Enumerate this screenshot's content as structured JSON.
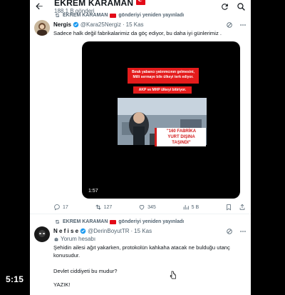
{
  "header": {
    "title": "EKREM KARAMAN",
    "post_count": "188,1 B gönderi"
  },
  "tweet1": {
    "retweet_by": "EKREM KARAMAN",
    "retweet_label": "gönderiyi yeniden yayınladı",
    "name": "Nergis",
    "handle": "@Kara25Nergiz",
    "dot": "·",
    "date": "15 Kas",
    "text": "Sadece halk değil fabrikalarimiz da göç ediyor, bu daha iyi günlerimiz .",
    "video": {
      "banner1_line1": "Bırak yabancı yatırımcının gelmesini,",
      "banner1_line2": "Milli sermaye bile ülkeyi terk ediyor.",
      "banner2": "AKP ve MHP ülkeyi bitiriyor.",
      "caption_line1": "\"160 FABRİKA",
      "caption_line2": "YURT DIŞINA",
      "caption_line3": "TAŞINDI\"",
      "duration": "1:57"
    },
    "actions": {
      "replies": "17",
      "reposts": "127",
      "likes": "345",
      "views": "5 B"
    }
  },
  "tweet2": {
    "retweet_by": "EKREM KARAMAN",
    "retweet_label": "gönderiyi yeniden yayınladı",
    "name": "N e f i s e",
    "handle": "@DerinBoyutTR",
    "dot": "·",
    "date": "15 Kas",
    "account_type": "Yorum hesabı",
    "text_line1": "Şehidin ailesi ağıt yakarken, protokolün kahkaha atacak ne bulduğu utanç",
    "text_line2": "konusudur.",
    "text_line3": "Devlet ciddiyeti bu mudur?",
    "text_line4": "YAZIK!"
  },
  "overlay": {
    "clock": "5:15"
  },
  "colors": {
    "accent": "#1d9bf0",
    "text": "#0f1419",
    "muted": "#536471",
    "flag": "#e30a17"
  }
}
